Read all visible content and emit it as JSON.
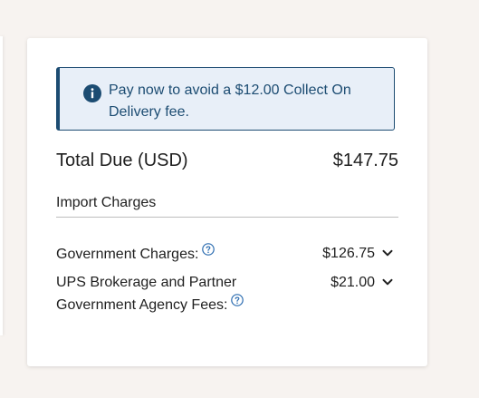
{
  "alert": {
    "icon": "info-icon",
    "message": "Pay now to avoid a $12.00 Collect On Delivery fee."
  },
  "total": {
    "label": "Total Due (USD)",
    "value": "$147.75"
  },
  "import_charges": {
    "title": "Import Charges",
    "items": [
      {
        "label": "Government Charges:",
        "value": "$126.75",
        "help_icon": "help-circle-icon",
        "toggle_icon": "chevron-down-icon"
      },
      {
        "label": "UPS Brokerage and Partner Government Agency Fees:",
        "value": "$21.00",
        "help_icon": "help-circle-icon",
        "toggle_icon": "chevron-down-icon"
      }
    ]
  },
  "colors": {
    "accent": "#1c4c72",
    "alert_background": "#e8eff8",
    "page_background": "#f7f3f0",
    "help_icon": "#2b6cb0"
  }
}
